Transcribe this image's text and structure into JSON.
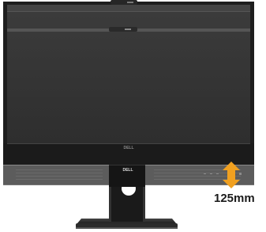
{
  "illustration": {
    "monitor_logo": "DELL",
    "bezel_logo": "DELL",
    "dimension_label": "125mm",
    "arrow_icon": "double-headed-vertical-arrow-icon"
  },
  "colors": {
    "bezel": "#222222",
    "screen": "#3a3a3a",
    "stand": "#1c1c1c",
    "base": "#2a2a2a",
    "arrow": "#f0a020",
    "background": "#ffffff"
  }
}
